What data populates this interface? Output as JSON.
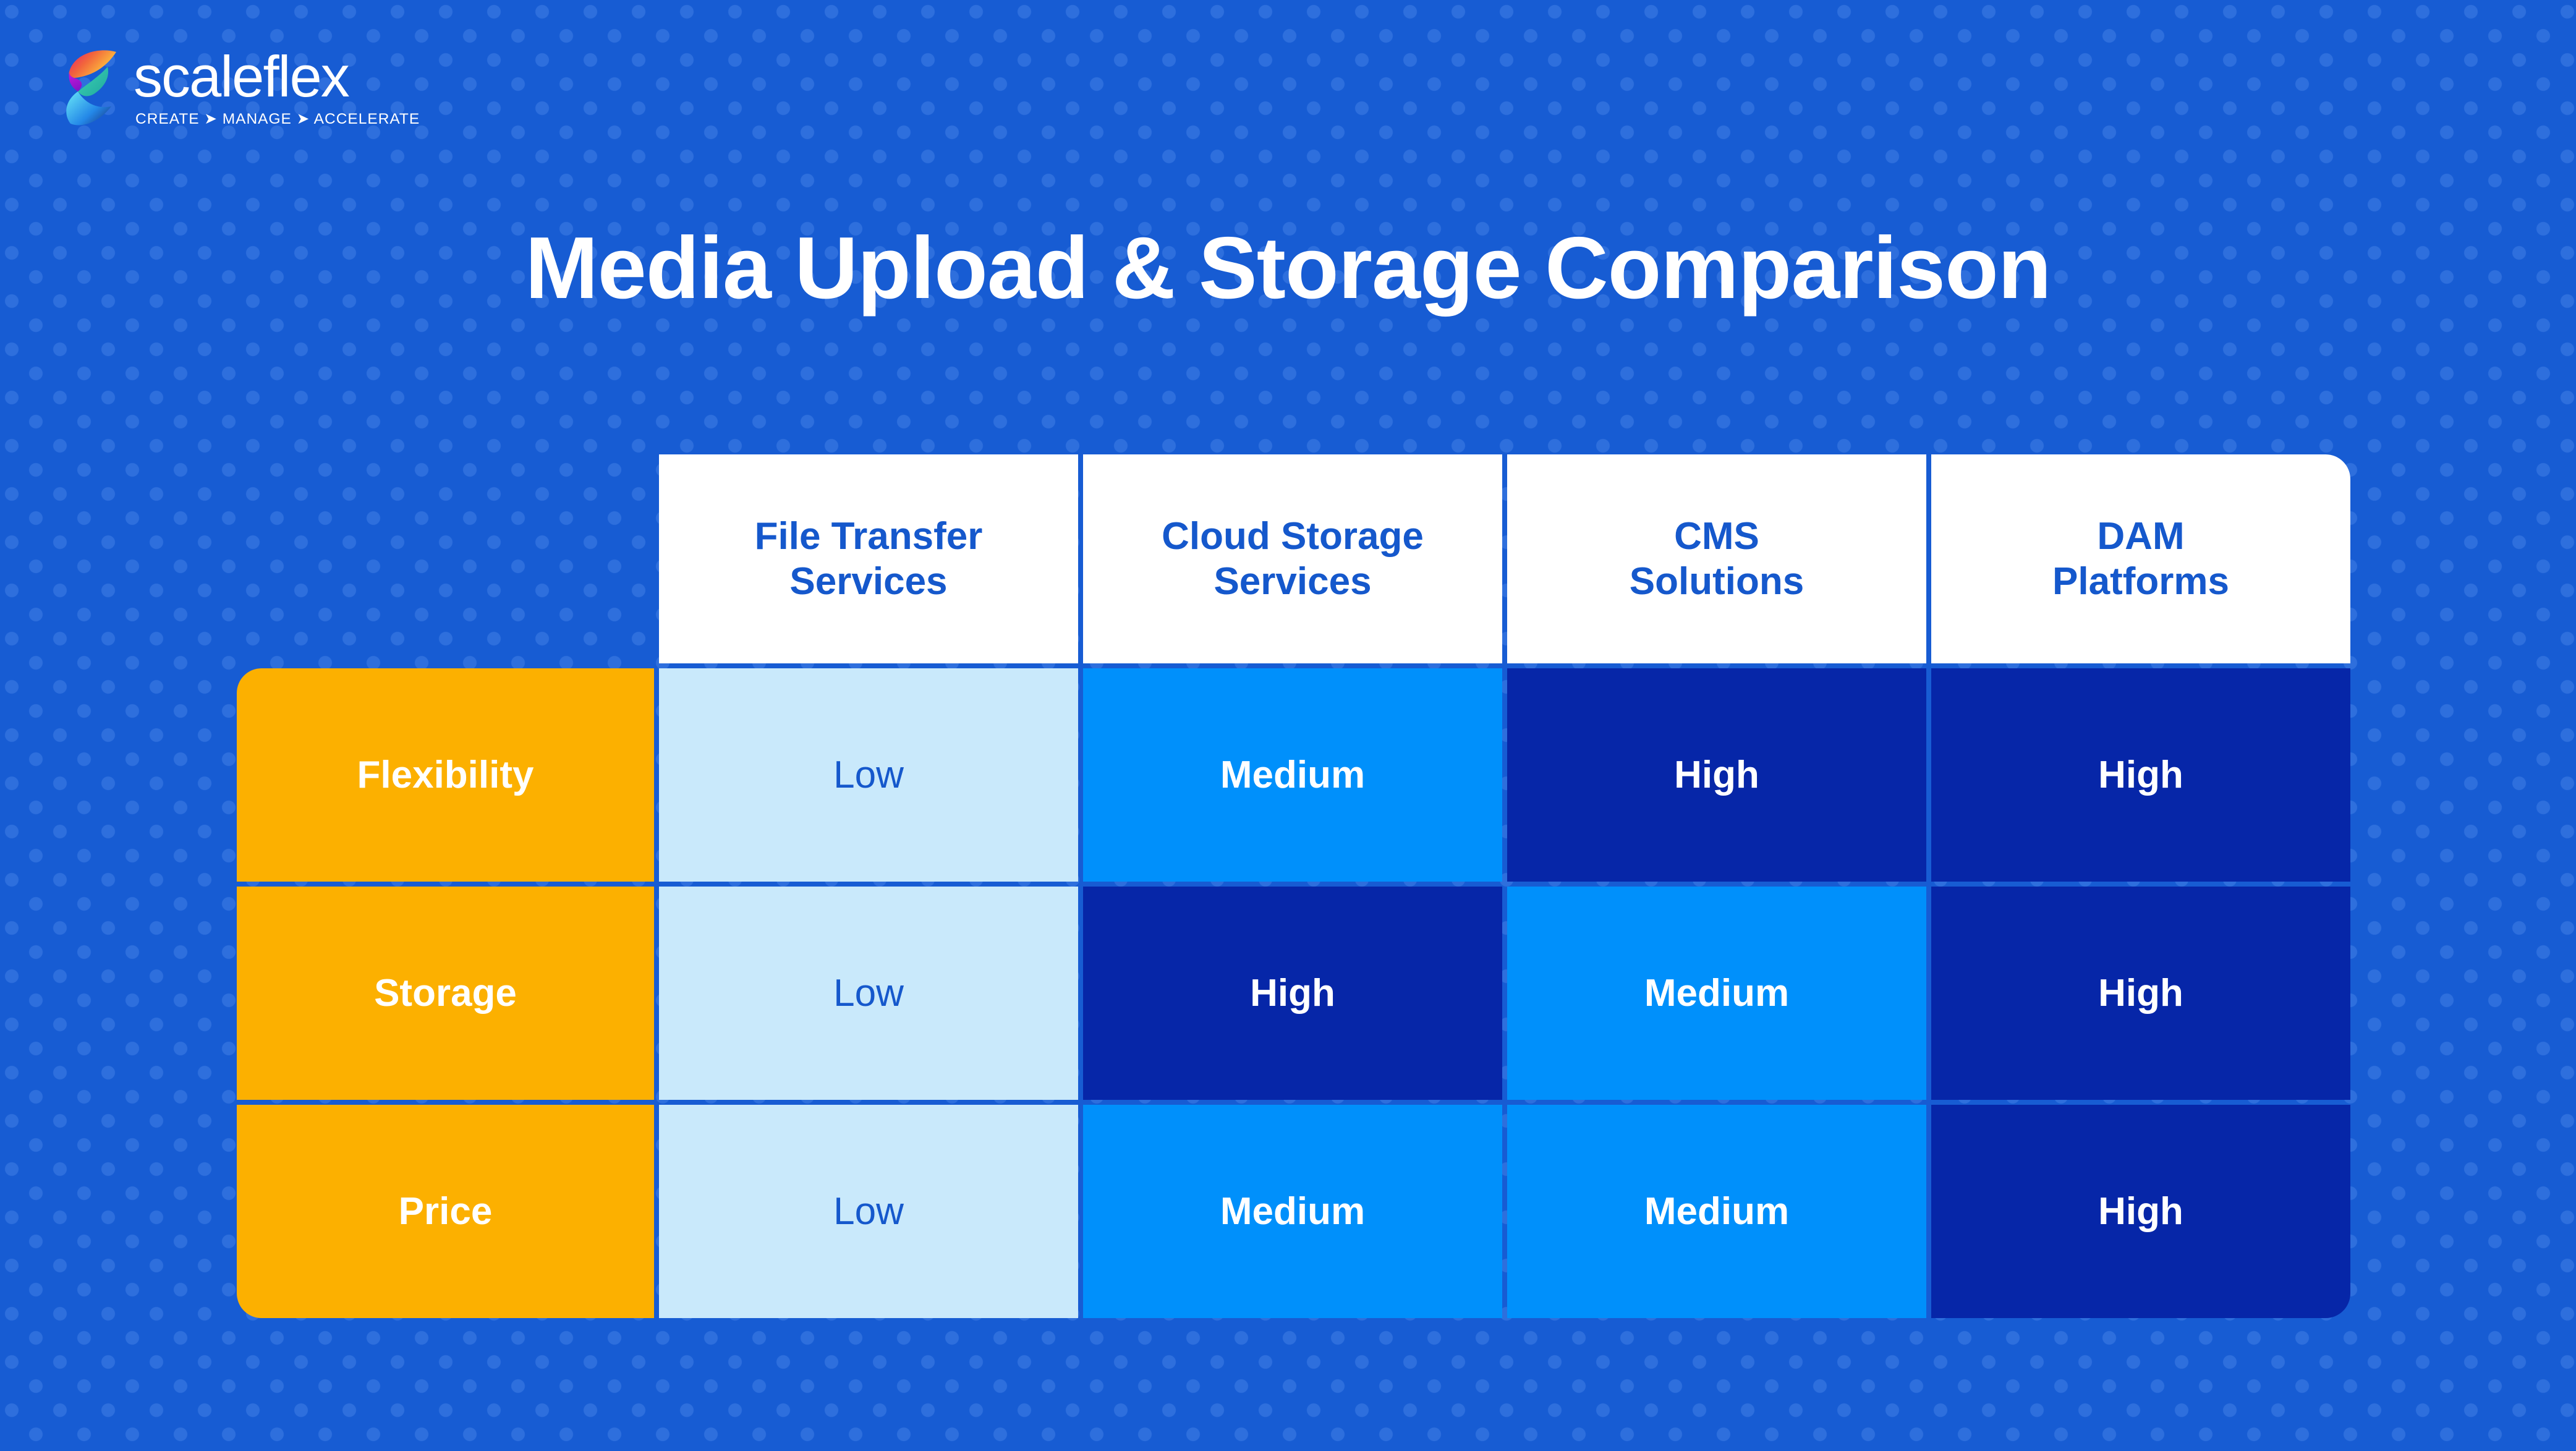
{
  "brand": {
    "name": "scaleflex",
    "tagline": "CREATE ➤ MANAGE ➤ ACCELERATE",
    "logo_icon": "scaleflex-s-ribbon-logo"
  },
  "title": "Media Upload & Storage Comparison",
  "colors": {
    "background": "#175CD3",
    "background_dot": "#2E6FDD",
    "header_bg": "#FFFFFF",
    "header_text": "#1558CC",
    "label_bg": "#FCB000",
    "label_text": "#FFFFFF",
    "low_bg": "#C9E9FB",
    "low_text": "#1558CC",
    "medium_bg": "#0090FB",
    "medium_text": "#FFFFFF",
    "high_bg": "#0626A8",
    "high_text": "#FFFFFF",
    "title_text": "#FFFFFF"
  },
  "table": {
    "corner_label": "",
    "columns": [
      {
        "label": "File Transfer Services",
        "line1": "File Transfer",
        "line2": "Services"
      },
      {
        "label": "Cloud Storage Services",
        "line1": "Cloud Storage",
        "line2": "Services"
      },
      {
        "label": "CMS Solutions",
        "line1": "CMS",
        "line2": "Solutions"
      },
      {
        "label": "DAM Platforms",
        "line1": "DAM",
        "line2": "Platforms"
      }
    ],
    "rows": [
      {
        "label": "Flexibility",
        "cells": [
          {
            "value": "Low",
            "level": "low"
          },
          {
            "value": "Medium",
            "level": "medium"
          },
          {
            "value": "High",
            "level": "high"
          },
          {
            "value": "High",
            "level": "high"
          }
        ]
      },
      {
        "label": "Storage",
        "cells": [
          {
            "value": "Low",
            "level": "low"
          },
          {
            "value": "High",
            "level": "high"
          },
          {
            "value": "Medium",
            "level": "medium"
          },
          {
            "value": "High",
            "level": "high"
          }
        ]
      },
      {
        "label": "Price",
        "cells": [
          {
            "value": "Low",
            "level": "low"
          },
          {
            "value": "Medium",
            "level": "medium"
          },
          {
            "value": "Medium",
            "level": "medium"
          },
          {
            "value": "High",
            "level": "high"
          }
        ]
      }
    ]
  }
}
